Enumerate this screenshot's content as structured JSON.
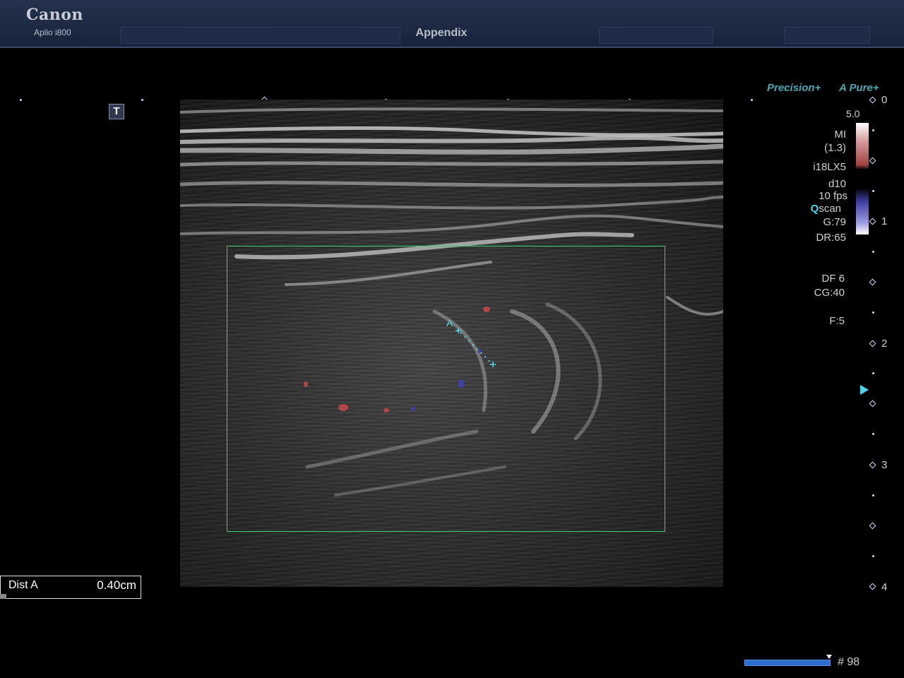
{
  "header": {
    "brand": "Canon",
    "model": "Aplio i800",
    "title": "Appendix"
  },
  "image_tools": {
    "text_button": "T"
  },
  "right_panel": {
    "logo_precision": "Precision+",
    "logo_apure": "A Pure+",
    "color_scale_max": "5.0",
    "mi_label": "MI",
    "mi_value": "(1.3)",
    "probe": "i18LX5",
    "depth_setting": "d10",
    "frame_rate": "10 fps",
    "qscan_prefix": "Q",
    "qscan_suffix": "scan",
    "gain": "G:79",
    "dynamic_range": "DR:65",
    "df": "DF 6",
    "color_gain": "CG:40",
    "focus": "F:5"
  },
  "depth_scale": {
    "labels": [
      "0",
      "1",
      "2",
      "3",
      "4"
    ]
  },
  "measurement": {
    "label": "Dist A",
    "value": "0.40",
    "unit": "cm",
    "marker": "A"
  },
  "cine": {
    "frame": "# 98"
  },
  "colors": {
    "roi": "#3fcf6f",
    "accent": "#4fd6e6",
    "header": "#1b2742"
  }
}
